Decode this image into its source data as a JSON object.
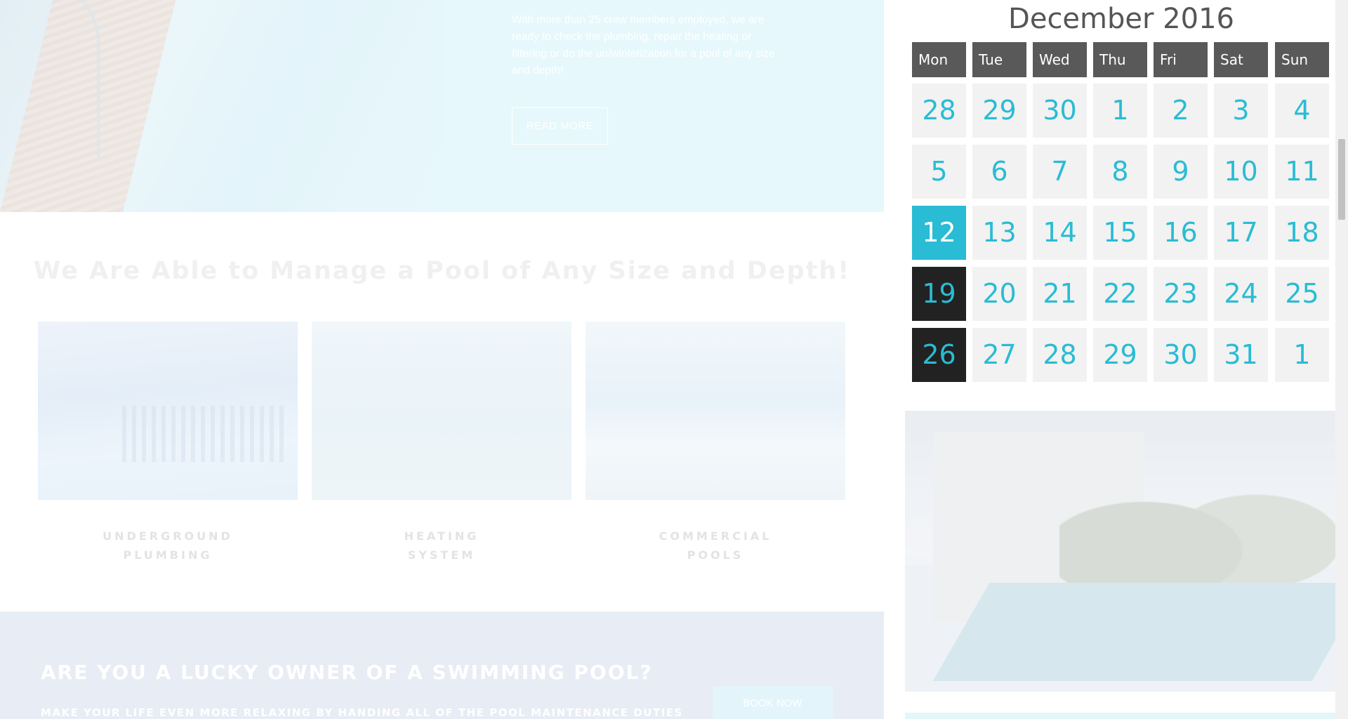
{
  "hero": {
    "paragraph": "With more than 25 crew members employed, we are ready to check the plumbing, repair the heating or filtering or do the un/winterization for a pool of any size and depth!",
    "read_more_label": "READ MORE"
  },
  "tagline": "We Are Able to Manage a Pool of Any Size and Depth!",
  "services": [
    {
      "line1": "UNDERGROUND",
      "line2": "PLUMBING"
    },
    {
      "line1": "HEATING",
      "line2": "SYSTEM"
    },
    {
      "line1": "COMMERCIAL",
      "line2": "POOLS"
    }
  ],
  "cta": {
    "title": "ARE YOU A LUCKY OWNER OF A SWIMMING POOL?",
    "subtitle": "MAKE YOUR LIFE EVEN MORE RELAXING BY HANDING ALL OF THE POOL MAINTENANCE DUTIES",
    "button_label": "BOOK NOW"
  },
  "calendar": {
    "title": "December 2016",
    "weekdays": [
      "Mon",
      "Tue",
      "Wed",
      "Thu",
      "Fri",
      "Sat",
      "Sun"
    ],
    "weeks": [
      [
        "28",
        "29",
        "30",
        "1",
        "2",
        "3",
        "4"
      ],
      [
        "5",
        "6",
        "7",
        "8",
        "9",
        "10",
        "11"
      ],
      [
        "12",
        "13",
        "14",
        "15",
        "16",
        "17",
        "18"
      ],
      [
        "19",
        "20",
        "21",
        "22",
        "23",
        "24",
        "25"
      ],
      [
        "26",
        "27",
        "28",
        "29",
        "30",
        "31",
        "1"
      ]
    ],
    "today": "12",
    "highlighted_dark": [
      "19",
      "26"
    ],
    "colors": {
      "accent": "#29bcd4",
      "header": "#595959",
      "cell": "#f2f2f2",
      "dark": "#222222"
    }
  }
}
